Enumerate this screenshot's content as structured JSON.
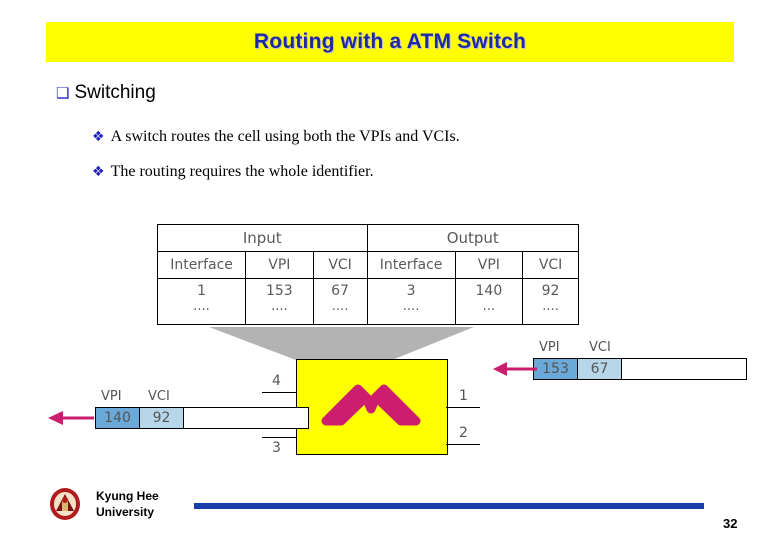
{
  "slide": {
    "title": "Routing with a ATM Switch",
    "page_number": "32",
    "bullets": {
      "level1": "Switching",
      "level1_marker": "❑",
      "items": [
        {
          "marker": "❖",
          "text": "A switch routes the cell using both the VPIs and VCIs."
        },
        {
          "marker": "❖",
          "text": "The routing requires the whole identifier."
        }
      ]
    },
    "table": {
      "group_headers": [
        "Input",
        "Output"
      ],
      "column_headers": [
        "Interface",
        "VPI",
        "VCI",
        "Interface",
        "VPI",
        "VCI"
      ],
      "rows": [
        [
          "1",
          "153",
          "67",
          "3",
          "140",
          "92"
        ]
      ],
      "continuation": [
        "....",
        "....",
        "....",
        "....",
        "...",
        "...."
      ]
    },
    "diagram": {
      "switch_ports": {
        "left": [
          "4",
          "3"
        ],
        "right": [
          "1",
          "2"
        ]
      },
      "incoming_cell": {
        "headers": [
          "VPI",
          "VCI"
        ],
        "vpi": "153",
        "vci": "67"
      },
      "outgoing_cell": {
        "headers": [
          "VPI",
          "VCI"
        ],
        "vpi": "140",
        "vci": "92"
      }
    },
    "footer": {
      "university_line1": "Kyung Hee",
      "university_line2": "University"
    },
    "colors": {
      "title_band": "#ffff00",
      "title_text": "#1f2aa0",
      "switch_box": "#ffff00",
      "switch_glyph": "#cc1d6e",
      "vpi_cell": "#6aa9d8",
      "vci_cell": "#b8d6ea",
      "arrow": "#cc1d6e",
      "footer_rule": "#1b3faa"
    }
  }
}
